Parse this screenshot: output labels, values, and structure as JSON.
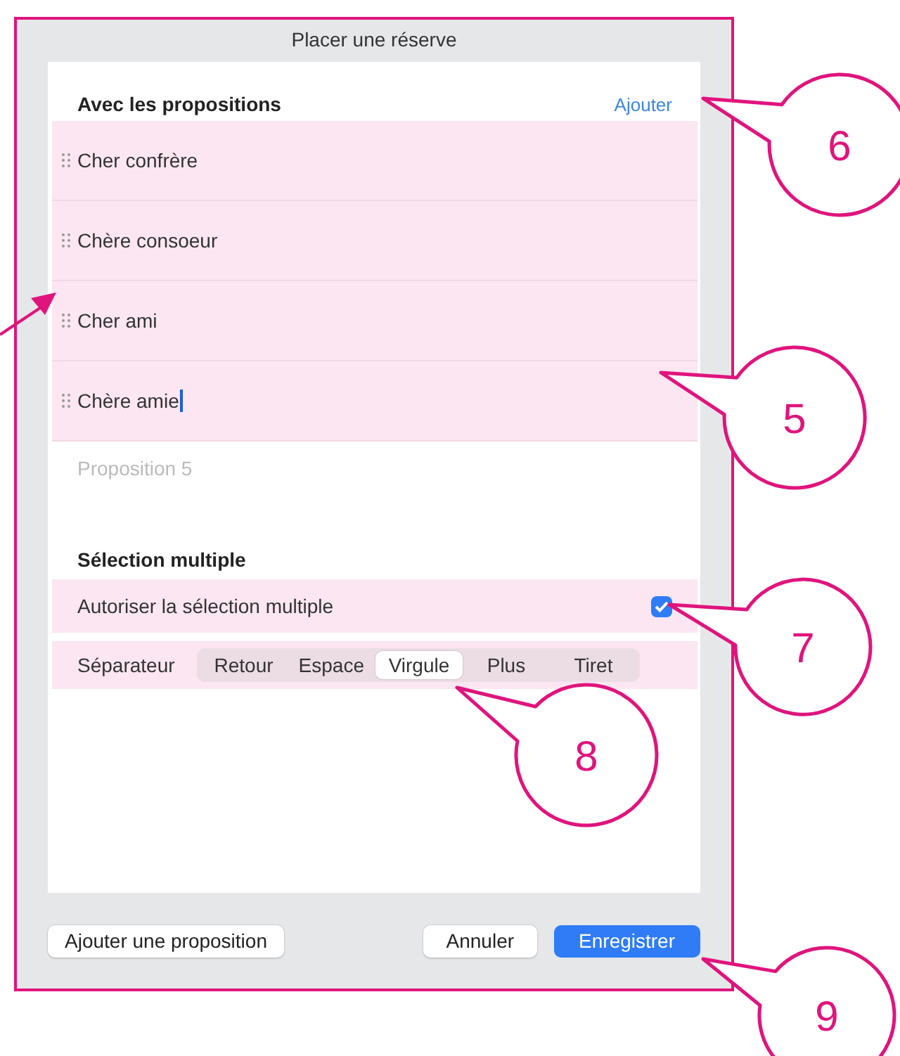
{
  "window": {
    "title": "Placer une réserve"
  },
  "propositions": {
    "heading": "Avec les propositions",
    "add_link": "Ajouter",
    "items": [
      {
        "text": "Cher confrère",
        "focused": false
      },
      {
        "text": "Chère consoeur",
        "focused": false
      },
      {
        "text": "Cher ami",
        "focused": false
      },
      {
        "text": "Chère amie",
        "focused": true
      }
    ],
    "new_item": {
      "placeholder": "Proposition 5"
    }
  },
  "multiple": {
    "heading": "Sélection multiple",
    "allow_label": "Autoriser la sélection multiple",
    "checked": true,
    "separator_label": "Séparateur",
    "separators": [
      {
        "label": "Retour",
        "selected": false
      },
      {
        "label": "Espace",
        "selected": false
      },
      {
        "label": "Virgule",
        "selected": true
      },
      {
        "label": "Plus",
        "selected": false
      },
      {
        "label": "Tiret",
        "selected": false
      }
    ]
  },
  "buttons": [
    {
      "label": "Ajouter une proposition",
      "kind": "plain"
    },
    {
      "label": "Annuler",
      "kind": "plain"
    },
    {
      "label": "Enregistrer",
      "kind": "primary"
    }
  ],
  "callouts": [
    {
      "label": "6"
    },
    {
      "label": "5"
    },
    {
      "label": "7"
    },
    {
      "label": "8"
    },
    {
      "label": "9"
    }
  ]
}
